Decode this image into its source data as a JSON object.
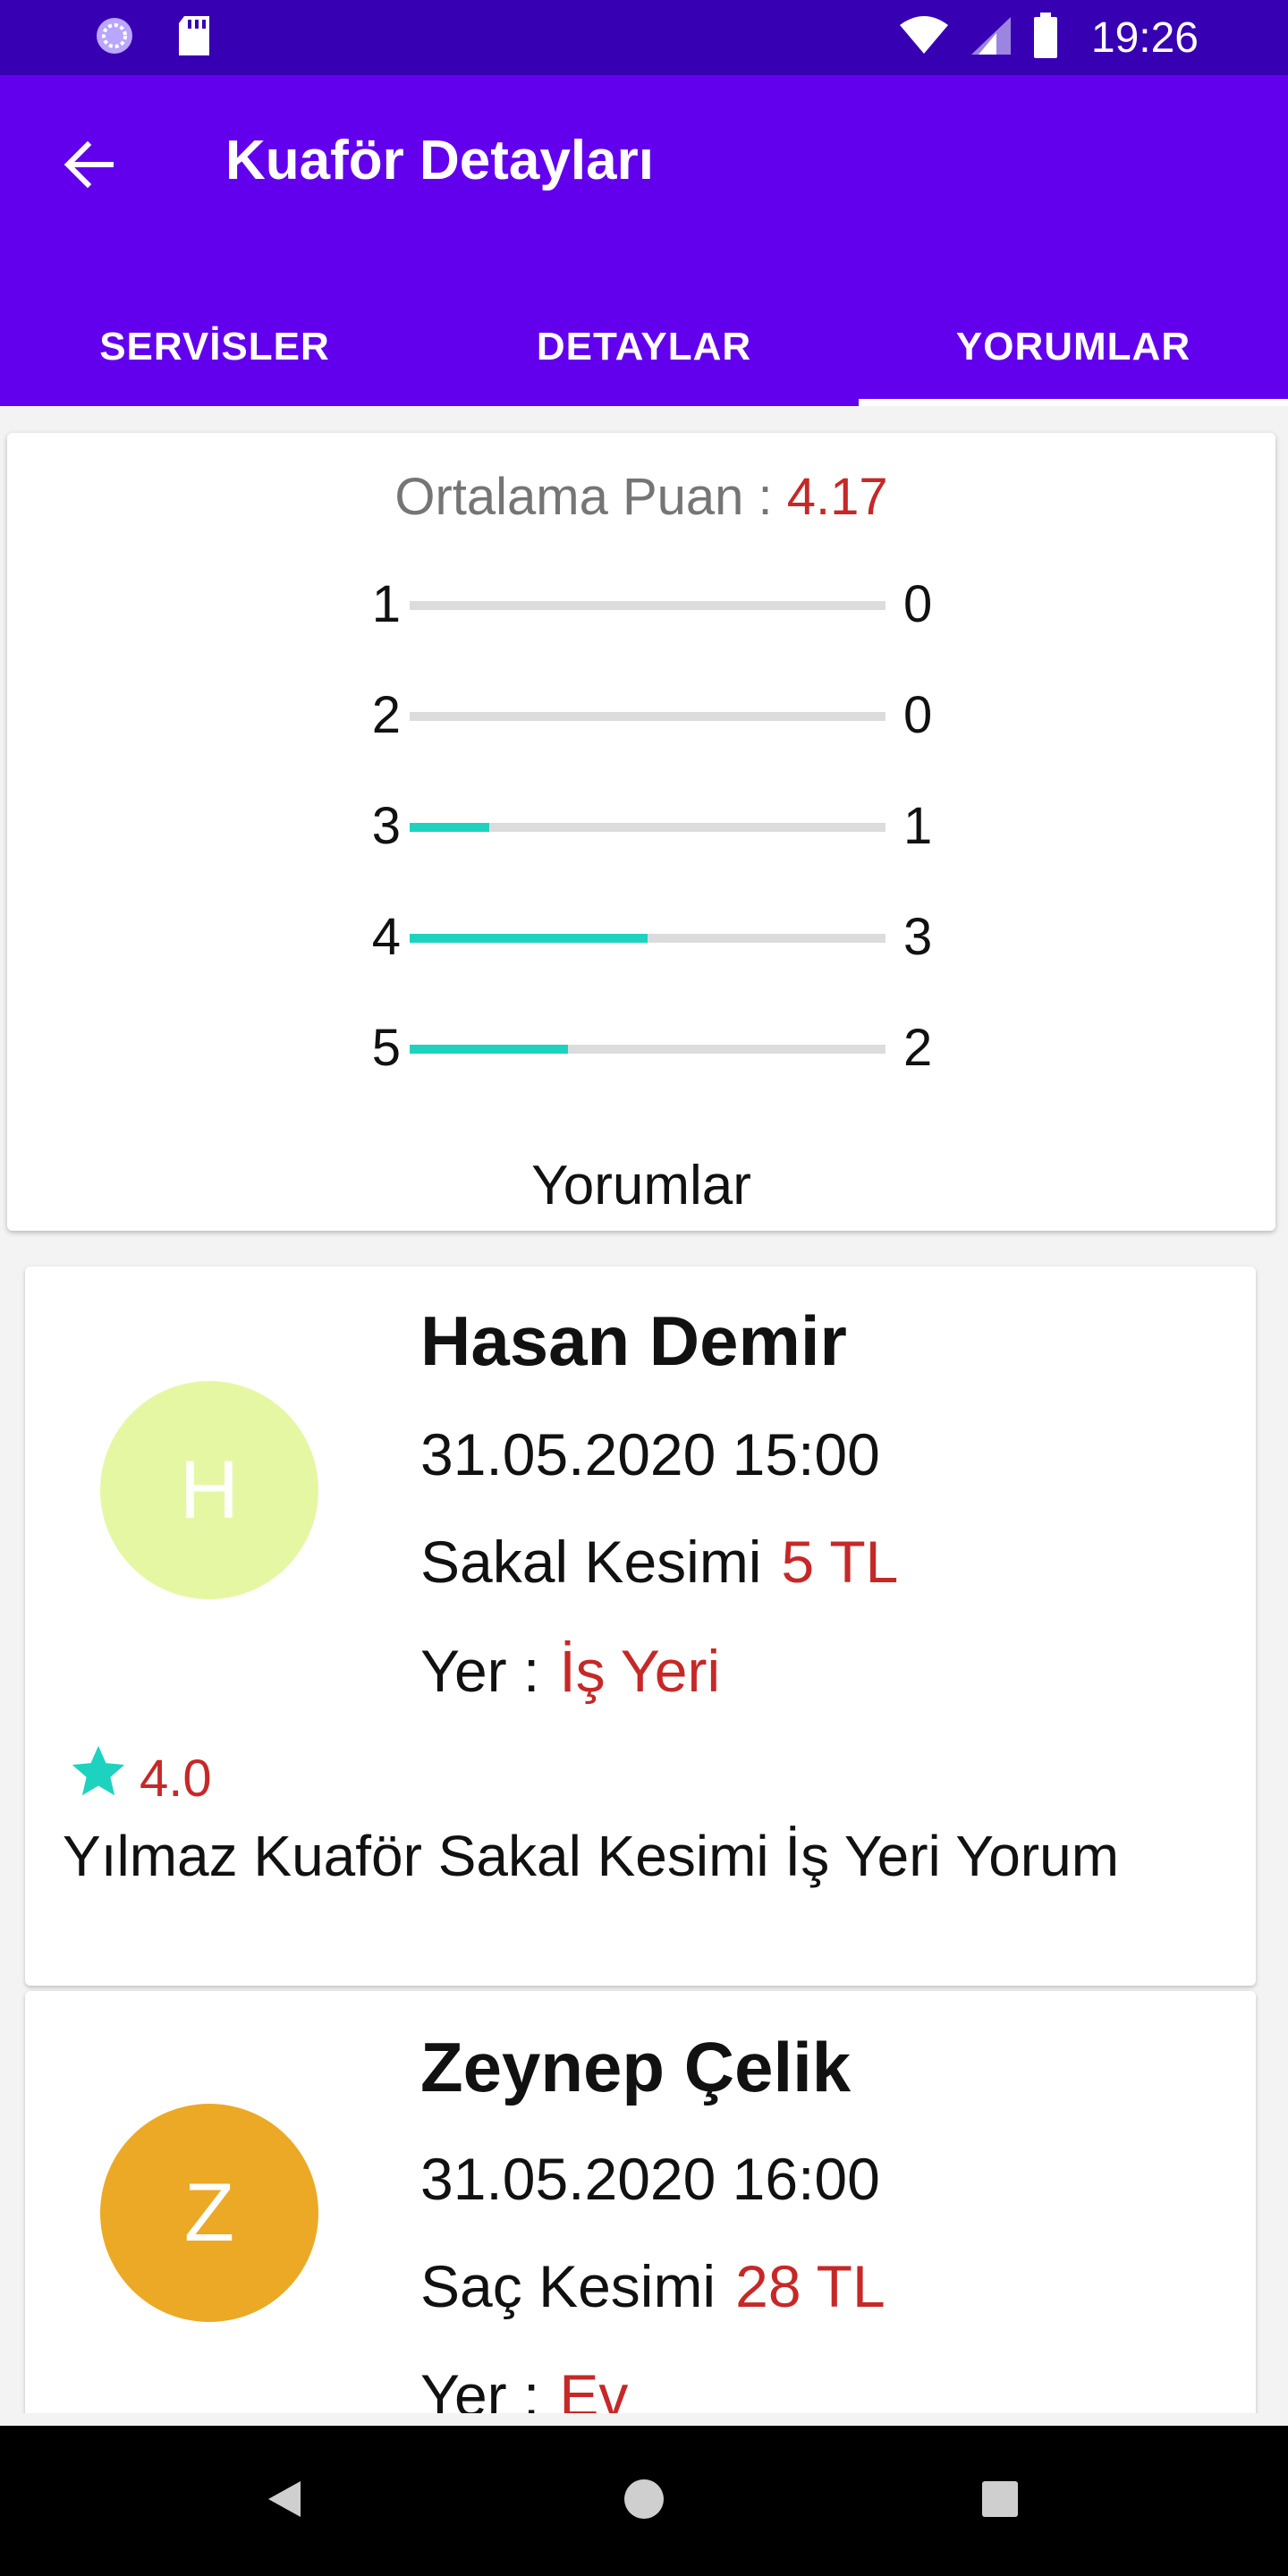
{
  "status_bar": {
    "time": "19:26"
  },
  "header": {
    "title": "Kuaför Detayları"
  },
  "tabs": [
    {
      "label": "SERVİSLER",
      "active": false
    },
    {
      "label": "DETAYLAR",
      "active": false
    },
    {
      "label": "YORUMLAR",
      "active": true
    }
  ],
  "rating_summary": {
    "average_label": "Ortalama Puan : ",
    "average_value": "4.17",
    "rows": [
      {
        "stars": "1",
        "count": "0",
        "fill_fraction": 0.0
      },
      {
        "stars": "2",
        "count": "0",
        "fill_fraction": 0.0
      },
      {
        "stars": "3",
        "count": "1",
        "fill_fraction": 0.167
      },
      {
        "stars": "4",
        "count": "3",
        "fill_fraction": 0.5
      },
      {
        "stars": "5",
        "count": "2",
        "fill_fraction": 0.333
      }
    ],
    "reviews_heading": "Yorumlar"
  },
  "reviews": [
    {
      "avatar_letter": "H",
      "avatar_color": "#e6f7a4",
      "name": "Hasan Demir",
      "datetime": "31.05.2020 15:00",
      "service": "Sakal Kesimi",
      "price": "5 TL",
      "place_label": "Yer :",
      "place": "İş Yeri",
      "rating": "4.0",
      "comment": "Yılmaz Kuaför Sakal Kesimi İş  Yeri Yorum"
    },
    {
      "avatar_letter": "Z",
      "avatar_color": "#eca926",
      "name": "Zeynep Çelik",
      "datetime": "31.05.2020 16:00",
      "service": "Saç Kesimi",
      "price": "28 TL",
      "place_label": "Yer :",
      "place": "Ev"
    }
  ],
  "colors": {
    "status_bar": "#3700b3",
    "app_bar": "#6200ee",
    "accent_red": "#c62828",
    "bar_fill": "#1dd3bf"
  }
}
